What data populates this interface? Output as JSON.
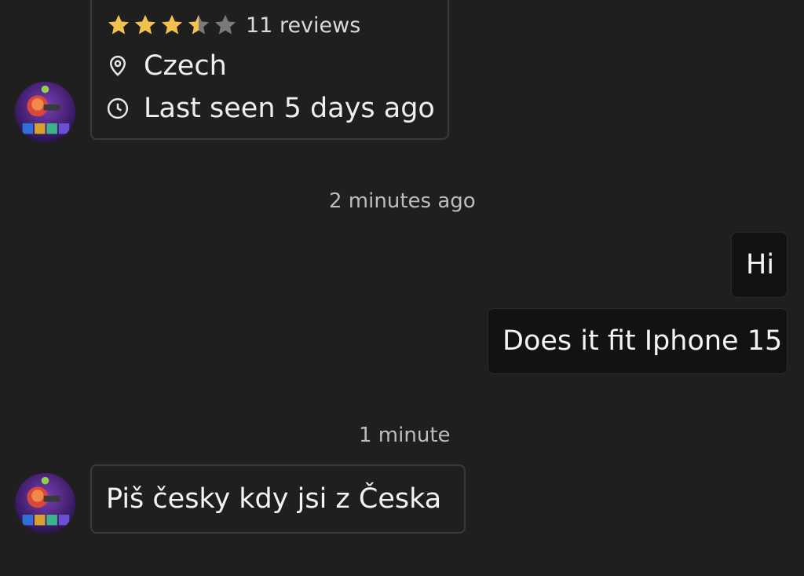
{
  "profile": {
    "rating": 3.5,
    "reviews": "11 reviews",
    "location": "Czech",
    "last_seen": "Last seen 5 days ago",
    "icons": {
      "location": "location-pin-icon",
      "clock": "clock-icon",
      "star": "star-icon"
    }
  },
  "colors": {
    "background": "#1f1f1f",
    "star_filled": "#f2c14e",
    "star_empty": "#7a7a7a",
    "sent_bubble": "#121212",
    "border": "#3a3a3a"
  },
  "messages": [
    {
      "timestamp": "2 minutes ago",
      "items": [
        {
          "direction": "sent",
          "text": "Hi"
        },
        {
          "direction": "sent",
          "text": "Does it fit Iphone 15"
        }
      ]
    },
    {
      "timestamp": "1 minute",
      "items": [
        {
          "direction": "received",
          "text": "Piš česky kdy jsi z Česka"
        }
      ]
    }
  ]
}
